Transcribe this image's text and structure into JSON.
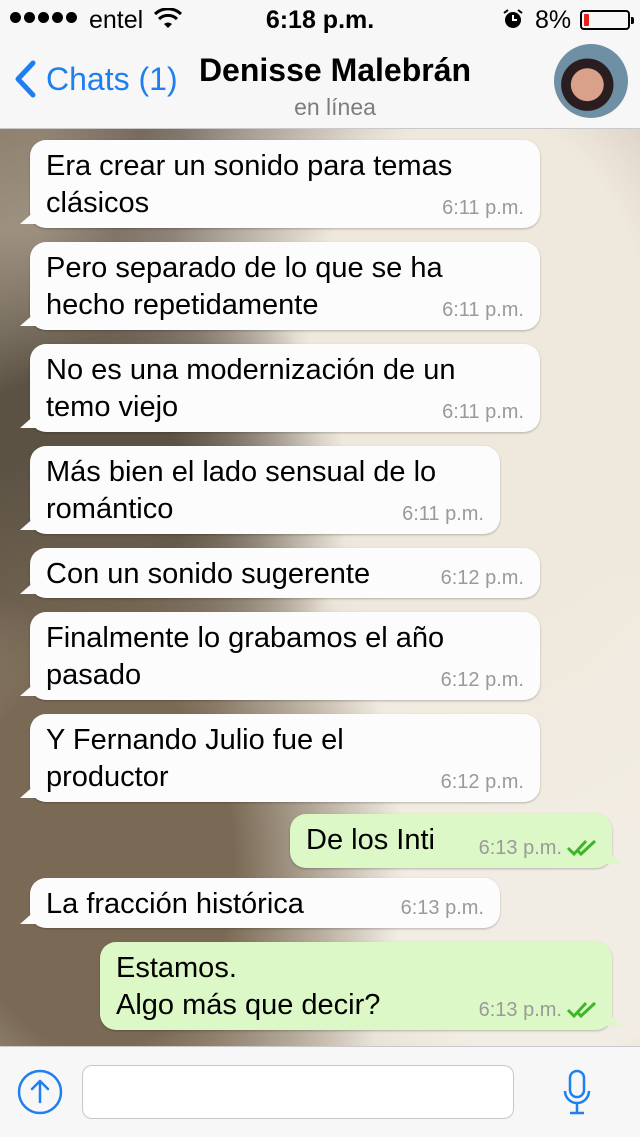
{
  "status_bar": {
    "carrier": "entel",
    "time": "6:18 p.m.",
    "battery": "8%"
  },
  "header": {
    "back_label": "Chats (1)",
    "contact_name": "Denisse Malebrán",
    "contact_status": "en línea"
  },
  "messages": [
    {
      "dir": "in",
      "text": "Era crear un sonido para temas\nclásicos",
      "time": "6:11 p.m."
    },
    {
      "dir": "in",
      "text": "Pero separado de lo que se ha\nhecho repetidamente",
      "time": "6:11 p.m."
    },
    {
      "dir": "in",
      "text": "No es una modernización de un\ntemo viejo",
      "time": "6:11 p.m."
    },
    {
      "dir": "in",
      "text": "Más bien el lado sensual de lo\nromántico",
      "time": "6:11 p.m."
    },
    {
      "dir": "in",
      "text": "Con un sonido sugerente",
      "time": "6:12 p.m."
    },
    {
      "dir": "in",
      "text": "Finalmente lo grabamos el año\npasado",
      "time": "6:12 p.m."
    },
    {
      "dir": "in",
      "text": "Y Fernando Julio fue el\nproductor",
      "time": "6:12 p.m."
    },
    {
      "dir": "out",
      "text": "De los Inti",
      "time": "6:13 p.m."
    },
    {
      "dir": "in",
      "text": "La fracción histórica",
      "time": "6:13 p.m."
    },
    {
      "dir": "out",
      "text": "Estamos.\nAlgo más que decir?",
      "time": "6:13 p.m."
    }
  ],
  "composer": {
    "value": "",
    "placeholder": ""
  },
  "colors": {
    "accent": "#1f7ff0",
    "outgoing_bubble": "#dcf8c6",
    "incoming_bubble": "#fcfcfc",
    "read_ticks": "#3fb52a"
  },
  "icons": {
    "back": "chevron-left-icon",
    "attach": "upload-icon",
    "mic": "microphone-icon",
    "read": "double-check-icon"
  }
}
